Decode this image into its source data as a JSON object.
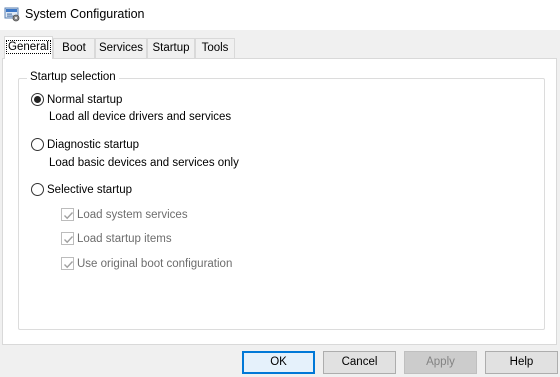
{
  "window": {
    "title": "System Configuration",
    "icon": "msconfig-icon"
  },
  "tabs": [
    {
      "label": "General",
      "active": true
    },
    {
      "label": "Boot",
      "active": false
    },
    {
      "label": "Services",
      "active": false
    },
    {
      "label": "Startup",
      "active": false
    },
    {
      "label": "Tools",
      "active": false
    }
  ],
  "startup_selection": {
    "legend": "Startup selection",
    "selected": "normal",
    "options": [
      {
        "id": "normal",
        "label": "Normal startup",
        "description": "Load all device drivers and services",
        "checked": true
      },
      {
        "id": "diagnostic",
        "label": "Diagnostic startup",
        "description": "Load basic devices and services only",
        "checked": false
      },
      {
        "id": "selective",
        "label": "Selective startup",
        "checked": false
      }
    ],
    "selective_items": [
      {
        "label": "Load system services",
        "checked": true,
        "enabled": false
      },
      {
        "label": "Load startup items",
        "checked": true,
        "enabled": false
      },
      {
        "label": "Use original boot configuration",
        "checked": true,
        "enabled": false
      }
    ]
  },
  "buttons": {
    "ok": "OK",
    "cancel": "Cancel",
    "apply": "Apply",
    "help": "Help"
  },
  "colors": {
    "accent": "#0078d7",
    "window": "#f0f0f0",
    "panel": "#ffffff",
    "disabled_text": "#6d6d6d"
  }
}
